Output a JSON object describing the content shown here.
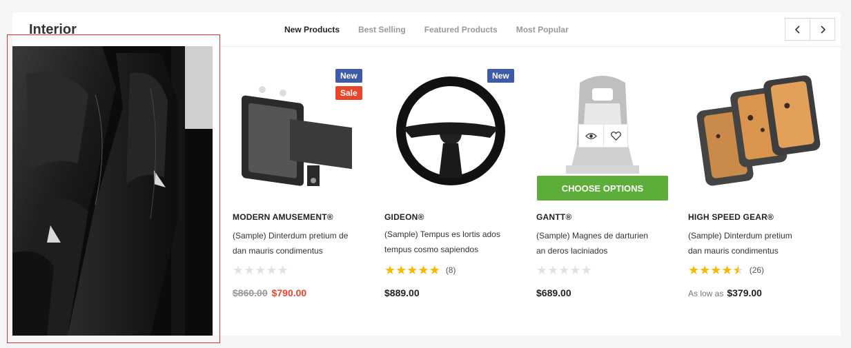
{
  "section": {
    "title": "Interior"
  },
  "tabs": [
    {
      "label": "New Products",
      "active": true
    },
    {
      "label": "Best Selling",
      "active": false
    },
    {
      "label": "Featured Products",
      "active": false
    },
    {
      "label": "Most Popular",
      "active": false
    }
  ],
  "nav": {
    "prev_icon": "chevron-left-icon",
    "next_icon": "chevron-right-icon"
  },
  "colors": {
    "accent_green": "#5cad3a",
    "badge_new": "#3f5aa8",
    "badge_sale": "#e9452a",
    "star": "#f6b900"
  },
  "products": [
    {
      "badges": [
        "New",
        "Sale"
      ],
      "brand": "MODERN AMUSEMENT®",
      "desc_line1": "(Sample) Dinterdum pretium de",
      "desc_line2": "dan mauris condimentus",
      "rating": 0,
      "reviews": "",
      "old_price": "$860.00",
      "price": "$790.00"
    },
    {
      "badges": [
        "New"
      ],
      "brand": "GIDEON®",
      "desc_line1": "(Sample) Tempus es lortis ados",
      "desc_line2": "tempus cosmo sapiendos",
      "rating": 5,
      "reviews": "(8)",
      "price": "$889.00"
    },
    {
      "badges": [],
      "brand": "GANTT®",
      "desc_line1": "(Sample) Magnes de darturien",
      "desc_line2": "an deros laciniados",
      "rating": 0,
      "reviews": "",
      "price": "$689.00",
      "choose_label": "CHOOSE OPTIONS",
      "quick_view_icon": "eye-icon",
      "wishlist_icon": "heart-icon"
    },
    {
      "badges": [],
      "brand": "HIGH SPEED GEAR®",
      "desc_line1": "(Sample) Dinterdum pretium",
      "desc_line2": "dan mauris condimentus",
      "rating": 4.5,
      "reviews": "(26)",
      "price_prefix": "As low as",
      "price": "$379.00"
    }
  ]
}
